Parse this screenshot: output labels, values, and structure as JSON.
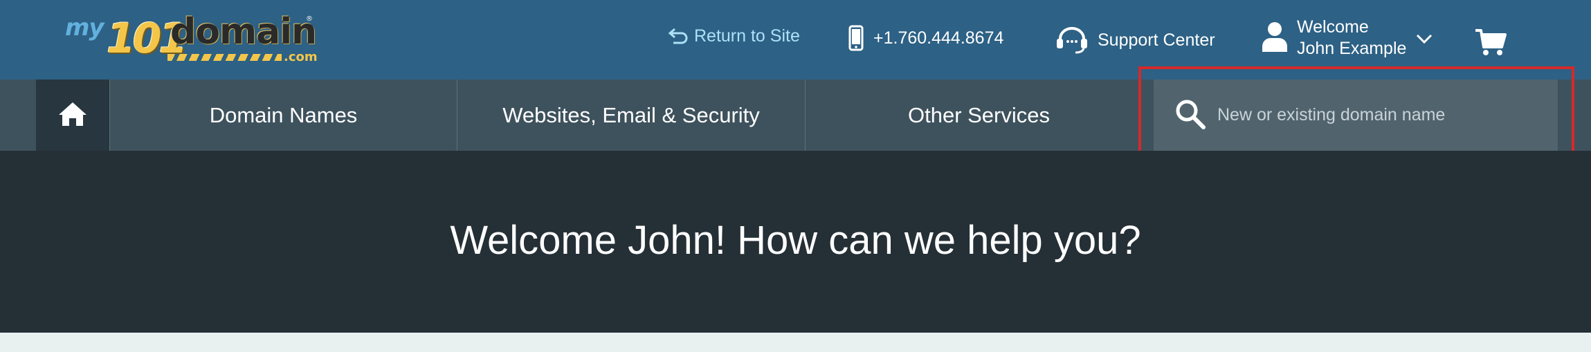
{
  "logo": {
    "my": "my",
    "number": "101",
    "word": "domain",
    "tld": ".com",
    "reg": "®"
  },
  "header": {
    "return_label": "Return to Site",
    "phone": "+1.760.444.8674",
    "support_label": "Support Center",
    "welcome_line1": "Welcome",
    "welcome_line2": "John Example"
  },
  "nav": {
    "items": [
      {
        "label": "Domain Names"
      },
      {
        "label": "Websites, Email & Security"
      },
      {
        "label": "Other Services"
      }
    ]
  },
  "search": {
    "placeholder": "New or existing domain name",
    "value": ""
  },
  "hero": {
    "title": "Welcome John! How can we help you?"
  },
  "colors": {
    "header_bg": "#2d6185",
    "nav_bg": "#3e525d",
    "search_bg": "#51646e",
    "hero_bg": "#252f36",
    "highlight": "#d52a2a",
    "link_accent": "#aee0f8"
  },
  "icons": [
    "return-arrow-icon",
    "phone-icon",
    "headset-icon",
    "user-icon",
    "chevron-down-icon",
    "cart-icon",
    "home-icon",
    "search-icon"
  ]
}
